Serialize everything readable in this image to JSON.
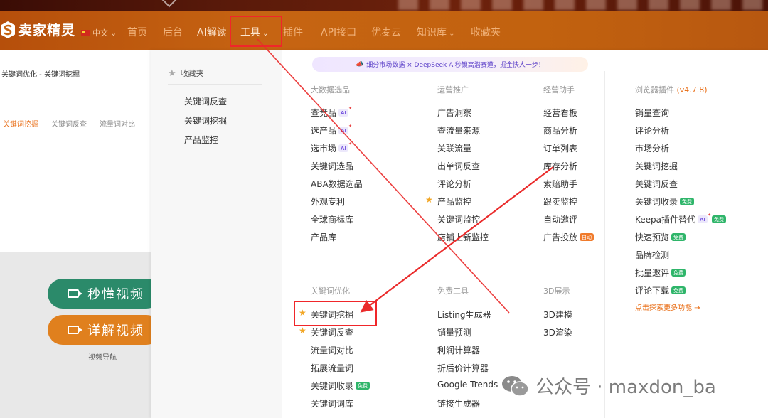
{
  "logo": {
    "text": "卖家精灵",
    "icon": "logo-s-icon"
  },
  "nav": {
    "language": "中文",
    "items": [
      "首页",
      "后台",
      "AI解读",
      "工具",
      "插件",
      "API接口",
      "优麦云",
      "知识库",
      "收藏夹"
    ]
  },
  "page": {
    "breadcrumb": "关键词优化 - 关键词挖掘",
    "tabs": [
      "关键词挖掘",
      "关键词反查",
      "流量词对比"
    ],
    "video_buttons": [
      "秒懂视频",
      "详解视频"
    ],
    "video_nav": "视频导航"
  },
  "favorites": {
    "title": "收藏夹",
    "items": [
      "关键词反查",
      "关键词挖掘",
      "产品监控"
    ]
  },
  "promo": "细分市场数据 × DeepSeek AI秒锁高潜赛道，掘金快人一步！",
  "menu": {
    "big_data": {
      "title": "大数据选品",
      "items": [
        {
          "label": "查竞品",
          "tag": "AI"
        },
        {
          "label": "选产品",
          "tag": "AI"
        },
        {
          "label": "选市场",
          "tag": "AI"
        },
        {
          "label": "关键词选品"
        },
        {
          "label": "ABA数据选品"
        },
        {
          "label": "外观专利"
        },
        {
          "label": "全球商标库"
        },
        {
          "label": "产品库"
        }
      ]
    },
    "ops": {
      "title": "运营推广",
      "items": [
        "广告洞察",
        "查流量来源",
        "关联流量",
        "出单词反查",
        "评论分析",
        "产品监控",
        "关键词监控",
        "店铺上新监控"
      ]
    },
    "assistant": {
      "title": "经营助手",
      "items": [
        {
          "label": "经营看板"
        },
        {
          "label": "商品分析"
        },
        {
          "label": "订单列表"
        },
        {
          "label": "库存分析"
        },
        {
          "label": "索赔助手"
        },
        {
          "label": "跟卖监控"
        },
        {
          "label": "自动邀评"
        },
        {
          "label": "广告投放",
          "tag": "自动"
        }
      ]
    },
    "plugin": {
      "title": "浏览器插件",
      "version": "(v4.7.8)",
      "items": [
        {
          "label": "销量查询"
        },
        {
          "label": "评论分析"
        },
        {
          "label": "市场分析"
        },
        {
          "label": "关键词挖掘"
        },
        {
          "label": "关键词反查"
        },
        {
          "label": "关键词收录",
          "tag": "免费"
        },
        {
          "label": "Keepa插件替代",
          "tag": "AI",
          "tag2": "免费"
        },
        {
          "label": "快速预览",
          "tag": "免费"
        },
        {
          "label": "品牌检测"
        },
        {
          "label": "批量邀评",
          "tag": "免费"
        },
        {
          "label": "评论下载",
          "tag": "免费"
        }
      ],
      "explore": "点击探索更多功能 →"
    },
    "keyword": {
      "title": "关键词优化",
      "items": [
        {
          "label": "关键词挖掘"
        },
        {
          "label": "关键词反查"
        },
        {
          "label": "流量词对比"
        },
        {
          "label": "拓展流量词"
        },
        {
          "label": "关键词收录",
          "tag": "免费"
        },
        {
          "label": "关键词词库"
        }
      ]
    },
    "free": {
      "title": "免费工具",
      "items": [
        "Listing生成器",
        "销量预测",
        "利润计算器",
        "折后价计算器",
        "Google Trends",
        "链接生成器"
      ]
    },
    "display3d": {
      "title": "3D展示",
      "items": [
        "3D建模",
        "3D渲染"
      ]
    }
  },
  "watermark": "公众号 · maxdon_ba",
  "colors": {
    "brand_orange": "#e86a10",
    "highlight_red": "#f0262a",
    "free_green": "#2fb56a",
    "ai_purple": "#7a5ae0"
  }
}
